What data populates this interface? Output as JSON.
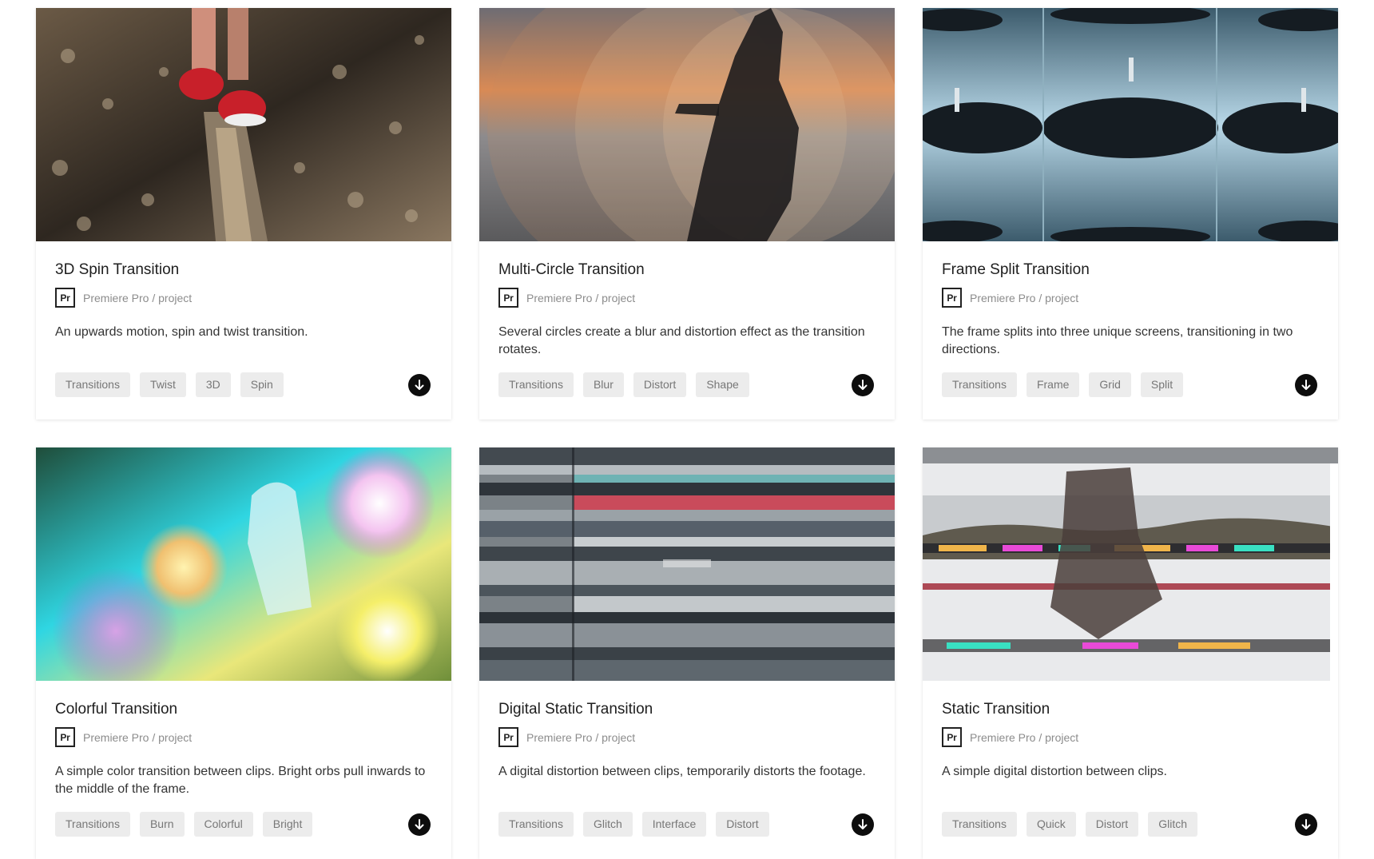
{
  "cards": [
    {
      "title": "3D Spin Transition",
      "badge": "Pr",
      "meta": "Premiere Pro / project",
      "description": "An upwards motion, spin and twist transition.",
      "tags": [
        "Transitions",
        "Twist",
        "3D",
        "Spin"
      ],
      "thumb_colors": [
        "#3a3128",
        "#7a6a55",
        "#c7b49a"
      ]
    },
    {
      "title": "Multi-Circle Transition",
      "badge": "Pr",
      "meta": "Premiere Pro / project",
      "description": "Several circles create a blur and distortion effect as the transition rotates.",
      "tags": [
        "Transitions",
        "Blur",
        "Distort",
        "Shape"
      ],
      "thumb_colors": [
        "#d98a55",
        "#8e8a89",
        "#2a2a2a"
      ]
    },
    {
      "title": "Frame Split Transition",
      "badge": "Pr",
      "meta": "Premiere Pro / project",
      "description": "The frame splits into three unique screens, transitioning in two directions.",
      "tags": [
        "Transitions",
        "Frame",
        "Grid",
        "Split"
      ],
      "thumb_colors": [
        "#9cc3d6",
        "#4f6e80",
        "#1a2630"
      ]
    },
    {
      "title": "Colorful Transition",
      "badge": "Pr",
      "meta": "Premiere Pro / project",
      "description": "A simple color transition between clips. Bright orbs pull inwards to the middle of the frame.",
      "tags": [
        "Transitions",
        "Burn",
        "Colorful",
        "Bright"
      ],
      "thumb_colors": [
        "#29e0e8",
        "#f3ef4a",
        "#c66ad8"
      ]
    },
    {
      "title": "Digital Static Transition",
      "badge": "Pr",
      "meta": "Premiere Pro / project",
      "description": "A digital distortion between clips, temporarily distorts the footage.",
      "tags": [
        "Transitions",
        "Glitch",
        "Interface",
        "Distort"
      ],
      "thumb_colors": [
        "#3a4750",
        "#c94b5b",
        "#b9bec2"
      ]
    },
    {
      "title": "Static Transition",
      "badge": "Pr",
      "meta": "Premiere Pro / project",
      "description": "A simple digital distortion between clips.",
      "tags": [
        "Transitions",
        "Quick",
        "Distort",
        "Glitch"
      ],
      "thumb_colors": [
        "#e9eaec",
        "#5b4946",
        "#39e0c2"
      ]
    }
  ]
}
